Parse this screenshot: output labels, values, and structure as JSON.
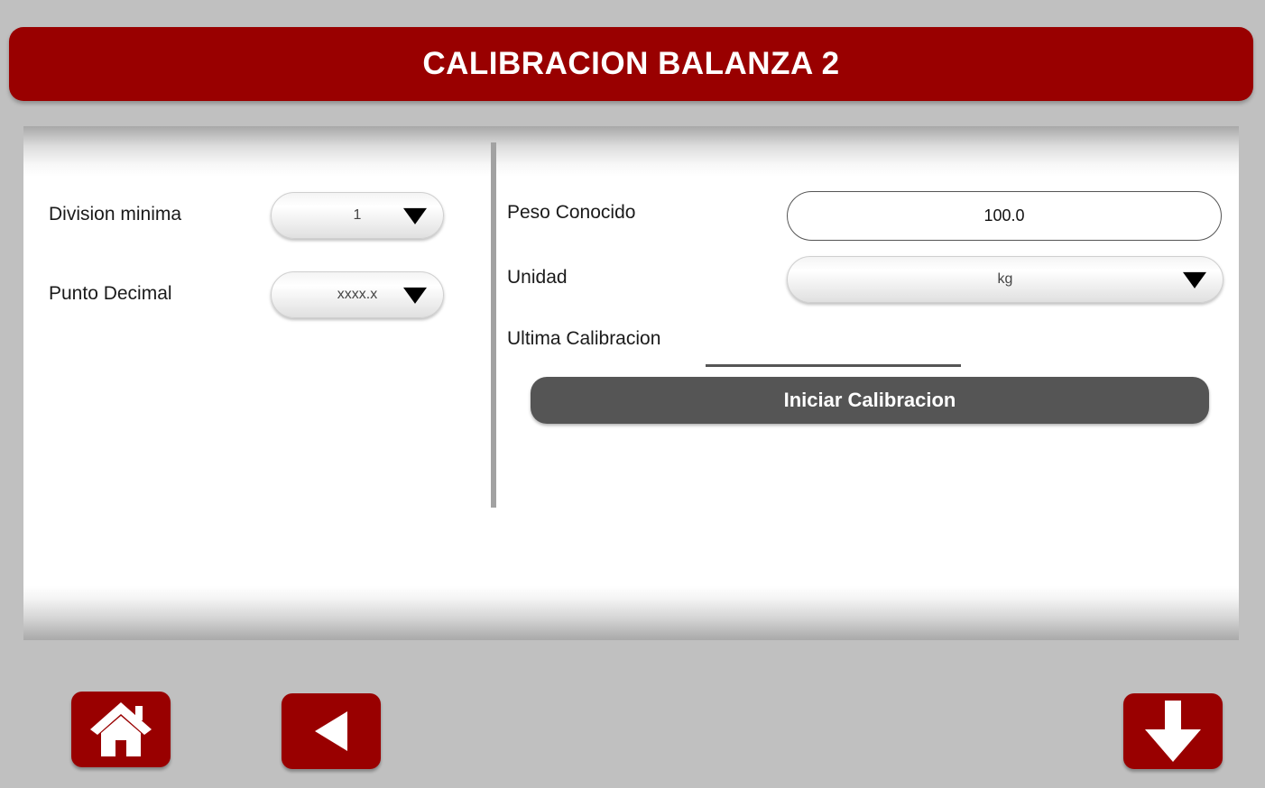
{
  "header": {
    "title": "CALIBRACION BALANZA 2"
  },
  "left": {
    "division_minima": {
      "label": "Division minima",
      "value": "1"
    },
    "punto_decimal": {
      "label": "Punto Decimal",
      "value": "xxxx.x"
    }
  },
  "right": {
    "peso_conocido": {
      "label": "Peso Conocido",
      "value": "100.0"
    },
    "unidad": {
      "label": "Unidad",
      "value": "kg"
    },
    "ultima_calibracion": {
      "label": "Ultima Calibracion",
      "value": ""
    },
    "start_button_label": "Iniciar Calibracion"
  },
  "nav": {
    "home_icon": "home-icon",
    "back_icon": "back-arrow-icon",
    "down_icon": "down-arrow-icon"
  },
  "colors": {
    "accent": "#990000",
    "background": "#c0c0c0",
    "button_dark": "#555555"
  }
}
